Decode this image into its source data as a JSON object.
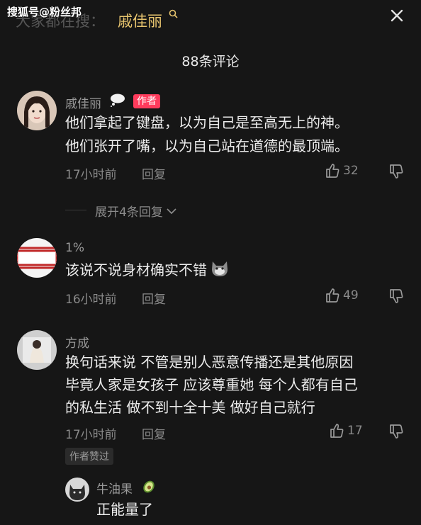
{
  "watermark": "搜狐号@粉丝邦",
  "search": {
    "hint": "大家都在搜：",
    "term": "戚佳丽"
  },
  "comment_count": "88条评论",
  "expand_label": "展开4条回复",
  "comments": [
    {
      "username": "戚佳丽",
      "author_badge": "作者",
      "lines": [
        "他们拿起了键盘，以为自己是至高无上的神。",
        "他们张开了嘴，以为自己站在道德的最顶端。"
      ],
      "time": "17小时前",
      "reply": "回复",
      "likes": "32"
    },
    {
      "username": "1%",
      "lines": [
        "该说不说身材确实不错"
      ],
      "time": "16小时前",
      "reply": "回复",
      "likes": "49"
    },
    {
      "username": "方成",
      "lines": [
        "换句话来说 不管是别人恶意传播还是其他原因",
        "毕竟人家是女孩子 应该尊重她 每个人都有自己",
        "的私生活 做不到十全十美 做好自己就行"
      ],
      "time": "17小时前",
      "reply": "回复",
      "likes": "17",
      "liked_badge": "作者赞过"
    }
  ],
  "sub_reply": {
    "username": "牛油果",
    "text": "正能量了"
  },
  "colors": {
    "background": "#161616",
    "accent_gold": "#e7c46e",
    "author_badge": "#ff3b5c"
  }
}
